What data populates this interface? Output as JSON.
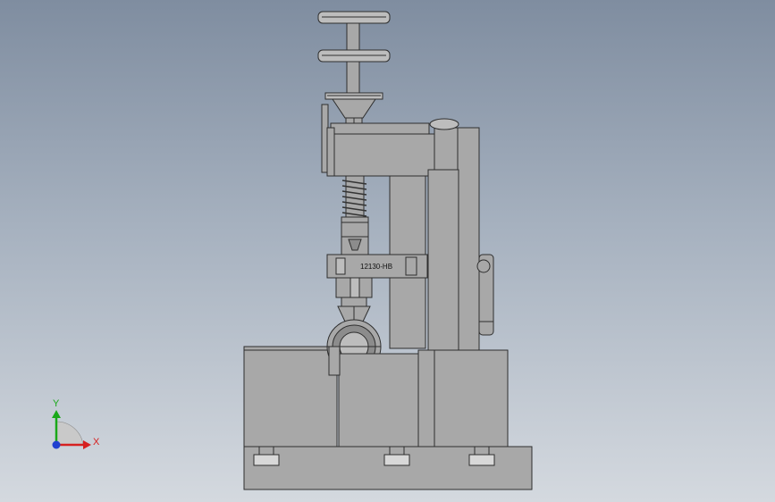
{
  "model": {
    "part_label": "12130-HB"
  },
  "triad": {
    "x_label": "X",
    "y_label": "Y",
    "x_color": "#d62020",
    "y_color": "#19a819",
    "z_color": "#2040d0"
  },
  "colors": {
    "background_top": "#7f8da0",
    "background_bottom": "#d4d9df",
    "part_fill": "#a8a8a8",
    "edge": "#2e2e2e"
  }
}
